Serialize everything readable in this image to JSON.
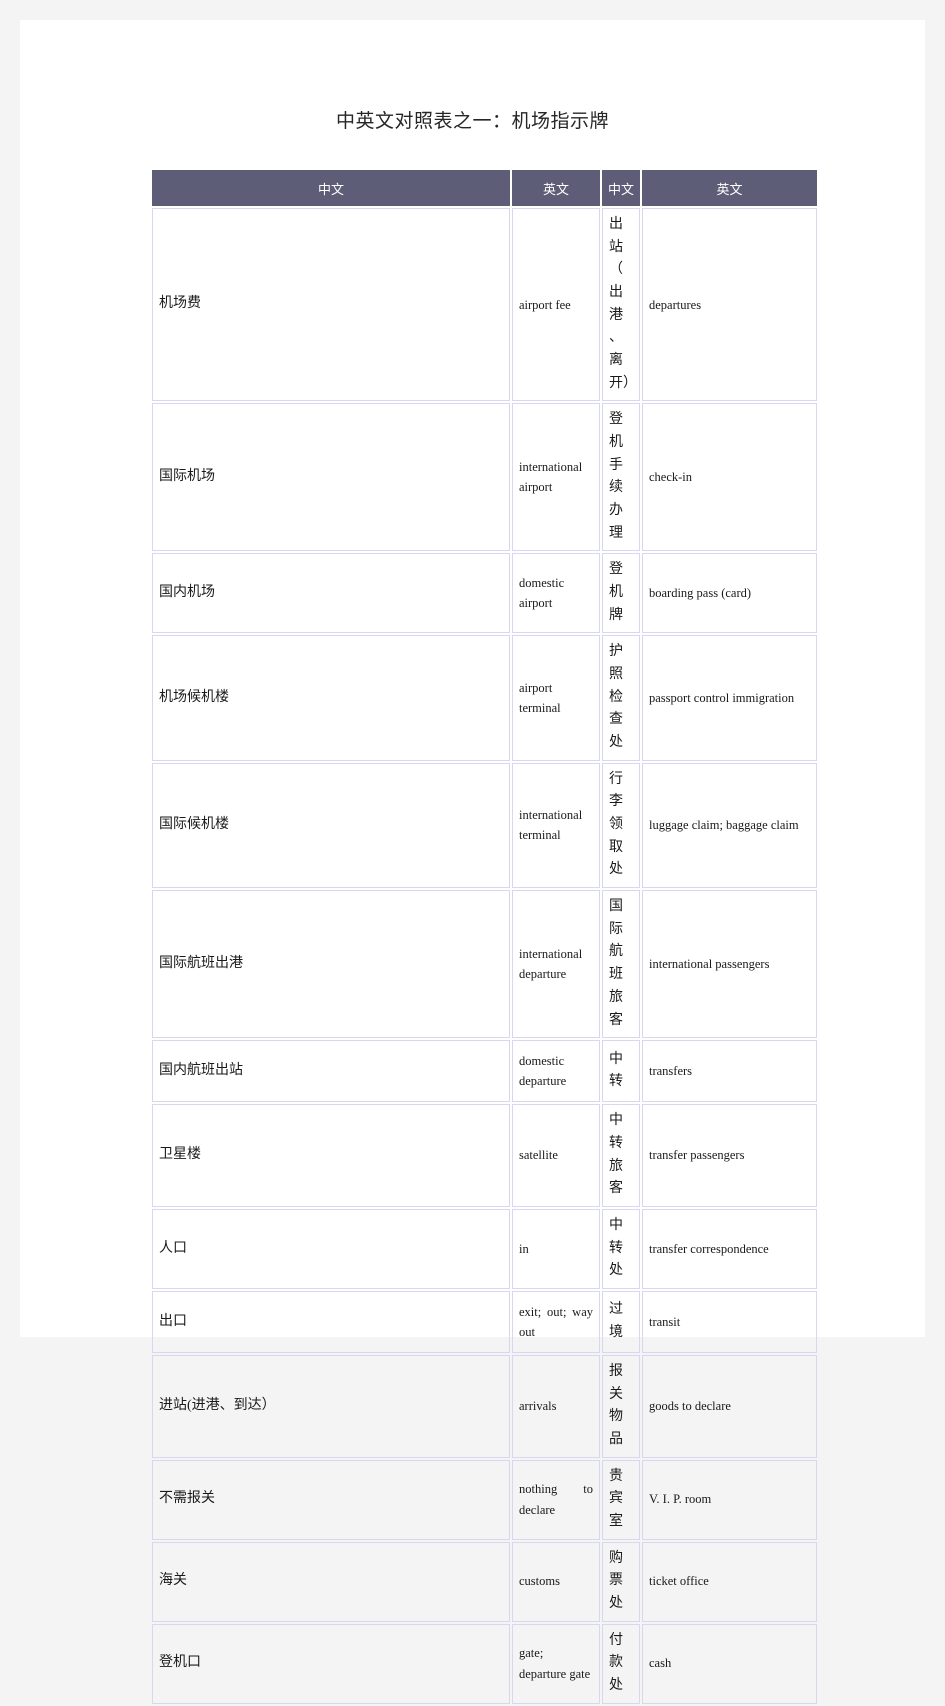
{
  "document": {
    "title": "中英文对照表之一：机场指示牌"
  },
  "table": {
    "headers": [
      "中文",
      "英文",
      "中文",
      "英文"
    ],
    "rows": [
      {
        "cn1": "机场费",
        "en1": "airport fee",
        "cn2": "出站（出港、离开）",
        "en2": "departures",
        "height": "tall"
      },
      {
        "cn1": "国际机场",
        "en1": "international airport",
        "cn2": "登机手续办理",
        "en2": "check-in",
        "height": "mid"
      },
      {
        "cn1": "国内机场",
        "en1": "domestic airport",
        "cn2": "登机牌",
        "en2": "boarding pass (card)",
        "height": "small"
      },
      {
        "cn1": "机场候机楼",
        "en1": "airport terminal",
        "cn2": "护照检查处",
        "en2": "passport control immigration",
        "height": "mid"
      },
      {
        "cn1": "国际候机楼",
        "en1": "international terminal",
        "cn2": "行李领取处",
        "en2": "luggage claim; baggage claim",
        "height": "mid"
      },
      {
        "cn1": "国际航班出港",
        "en1": "international departure",
        "cn2": "国际航班旅客",
        "en2": "international passengers",
        "height": "mid"
      },
      {
        "cn1": "国内航班出站",
        "en1": "domestic departure",
        "cn2": "中转",
        "en2": "transfers",
        "height": "small"
      },
      {
        "cn1": "卫星楼",
        "en1": "satellite",
        "cn2": "中转旅客",
        "en2": "transfer passengers",
        "height": "small"
      },
      {
        "cn1": "人口",
        "en1": "in",
        "cn2": "中转处",
        "en2": "transfer correspondence",
        "height": "small"
      },
      {
        "cn1": "出口",
        "en1": "exit; out; way out",
        "cn2": "过境",
        "en2": "transit",
        "height": "small"
      },
      {
        "cn1": "进站(进港、到达）",
        "en1": "arrivals",
        "cn2": "报关物品",
        "en2": "goods to declare",
        "height": "small"
      },
      {
        "cn1": "不需报关",
        "en1": "nothing to declare",
        "cn2": "贵宾室",
        "en2": "V. I. P. room",
        "height": "small"
      },
      {
        "cn1": "海关",
        "en1": "customs",
        "cn2": "购票处",
        "en2": "ticket office",
        "height": "small"
      },
      {
        "cn1": "登机口",
        "en1": "gate; departure gate",
        "cn2": "付款处",
        "en2": "cash",
        "height": "mid"
      }
    ]
  },
  "colors": {
    "header_bg": "#5d5d78",
    "header_text": "#ffffff",
    "cell_border": "#d7d7ef",
    "page_bg": "#ffffff",
    "canvas_bg": "#f4f4f4",
    "body_text": "#1a1a1a"
  }
}
